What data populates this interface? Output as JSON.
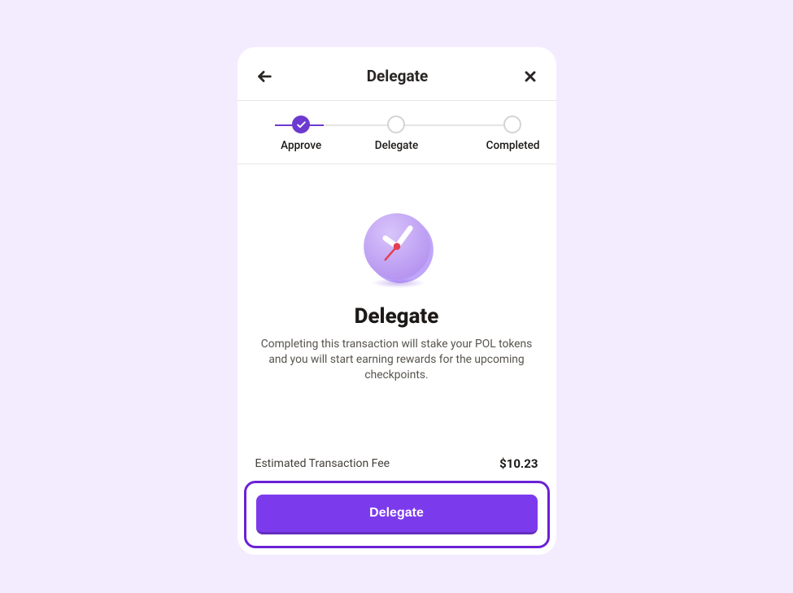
{
  "header": {
    "title": "Delegate"
  },
  "stepper": {
    "steps": [
      {
        "label": "Approve"
      },
      {
        "label": "Delegate"
      },
      {
        "label": "Completed"
      }
    ]
  },
  "content": {
    "title": "Delegate",
    "description": "Completing this transaction will stake your POL tokens and you will start earning rewards for the upcoming checkpoints."
  },
  "fee": {
    "label": "Estimated Transaction Fee",
    "value": "$10.23"
  },
  "action": {
    "button_label": "Delegate"
  }
}
